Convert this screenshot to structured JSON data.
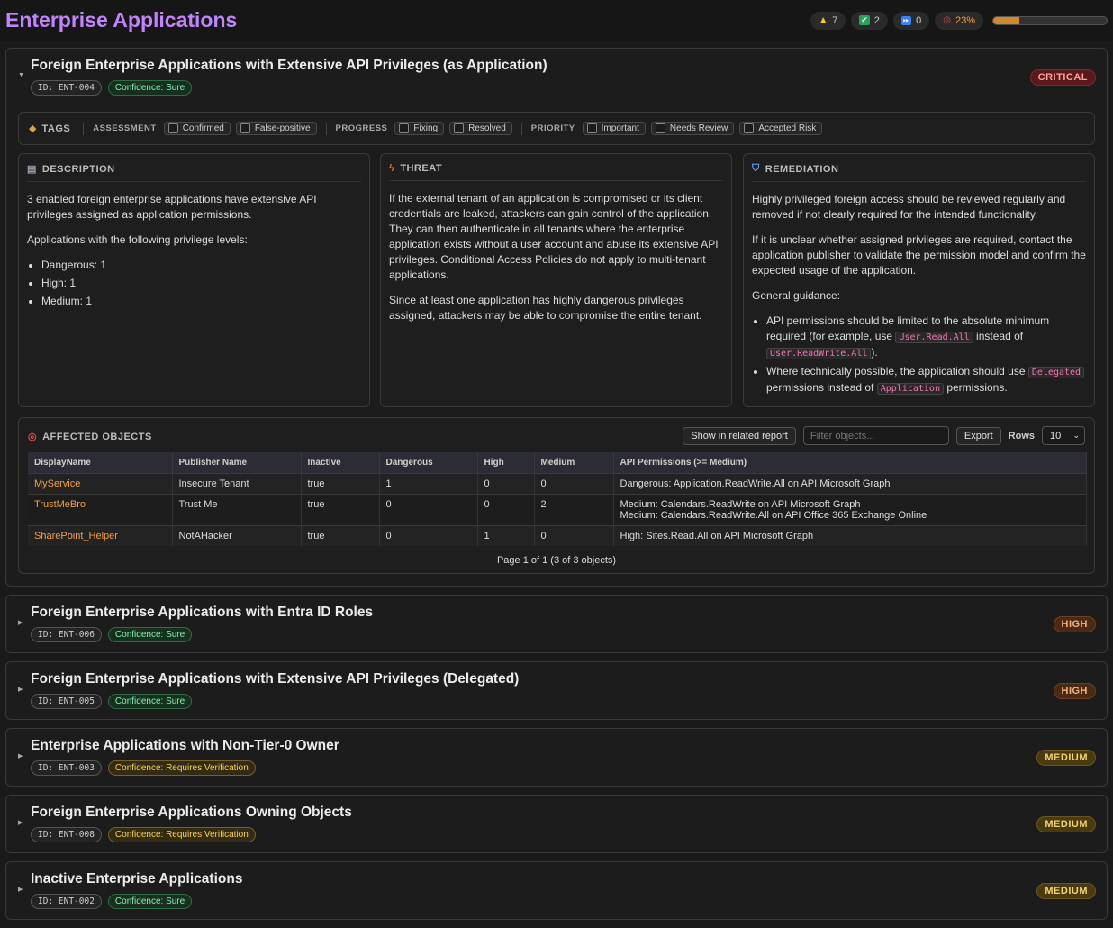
{
  "header": {
    "title": "Enterprise Applications",
    "stats": {
      "warnings": "7",
      "checked": "2",
      "skipped": "0",
      "progress_label": "23%",
      "progress_value": 0.23
    }
  },
  "expanded_finding": {
    "title": "Foreign Enterprise Applications with Extensive API Privileges (as Application)",
    "id": "ID: ENT-004",
    "confidence": "Confidence: Sure",
    "severity": "CRITICAL",
    "tags": {
      "title": "TAGS",
      "groups": [
        {
          "label": "ASSESSMENT",
          "options": [
            "Confirmed",
            "False-positive"
          ]
        },
        {
          "label": "PROGRESS",
          "options": [
            "Fixing",
            "Resolved"
          ]
        },
        {
          "label": "PRIORITY",
          "options": [
            "Important",
            "Needs Review",
            "Accepted Risk"
          ]
        }
      ]
    },
    "description": {
      "title": "DESCRIPTION",
      "p1": "3 enabled foreign enterprise applications have extensive API privileges assigned as application permissions.",
      "p2": "Applications with the following privilege levels:",
      "items": [
        "Dangerous: 1",
        "High: 1",
        "Medium: 1"
      ]
    },
    "threat": {
      "title": "THREAT",
      "p1": "If the external tenant of an application is compromised or its client credentials are leaked, attackers can gain control of the application. They can then authenticate in all tenants where the enterprise application exists without a user account and abuse its extensive API privileges. Conditional Access Policies do not apply to multi-tenant applications.",
      "p2": "Since at least one application has highly dangerous privileges assigned, attackers may be able to compromise the entire tenant."
    },
    "remediation": {
      "title": "REMEDIATION",
      "p1": "Highly privileged foreign access should be reviewed regularly and removed if not clearly required for the intended functionality.",
      "p2": "If it is unclear whether assigned privileges are required, contact the application publisher to validate the permission model and confirm the expected usage of the application.",
      "p3": "General guidance:",
      "b1_a": "API permissions should be limited to the absolute minimum required (for example, use",
      "b1_code1": "User.Read.All",
      "b1_b": "instead of",
      "b1_code2": "User.ReadWrite.All",
      "b1_c": ").",
      "b2_a": "Where technically possible, the application should use",
      "b2_code1": "Delegated",
      "b2_b": "permissions instead of",
      "b2_code2": "Application",
      "b2_c": "permissions."
    },
    "affected": {
      "title": "AFFECTED OBJECTS",
      "related_button": "Show in related report",
      "filter_placeholder": "Filter objects...",
      "export_button": "Export",
      "rows_label": "Rows",
      "rows_value": "10",
      "columns": [
        "DisplayName",
        "Publisher Name",
        "Inactive",
        "Dangerous",
        "High",
        "Medium",
        "API Permissions (>= Medium)"
      ],
      "rows": [
        {
          "name": "MyService",
          "publisher": "Insecure Tenant",
          "inactive": "true",
          "dangerous": "1",
          "high": "0",
          "medium": "0",
          "perm1": "Dangerous: Application.ReadWrite.All on API Microsoft Graph",
          "perm2": ""
        },
        {
          "name": "TrustMeBro",
          "publisher": "Trust Me",
          "inactive": "true",
          "dangerous": "0",
          "high": "0",
          "medium": "2",
          "perm1": "Medium: Calendars.ReadWrite on API Microsoft Graph",
          "perm2": "Medium: Calendars.ReadWrite.All on API Office 365 Exchange Online"
        },
        {
          "name": "SharePoint_Helper",
          "publisher": "NotAHacker",
          "inactive": "true",
          "dangerous": "0",
          "high": "1",
          "medium": "0",
          "perm1": "High: Sites.Read.All on API Microsoft Graph",
          "perm2": ""
        }
      ],
      "pager": "Page 1 of 1 (3 of 3 objects)"
    }
  },
  "collapsed_findings": [
    {
      "title": "Foreign Enterprise Applications with Entra ID Roles",
      "id": "ID: ENT-006",
      "confidence": "Confidence: Sure",
      "severity": "HIGH"
    },
    {
      "title": "Foreign Enterprise Applications with Extensive API Privileges (Delegated)",
      "id": "ID: ENT-005",
      "confidence": "Confidence: Sure",
      "severity": "HIGH"
    },
    {
      "title": "Enterprise Applications with Non-Tier-0 Owner",
      "id": "ID: ENT-003",
      "confidence": "Confidence: Requires Verification",
      "severity": "MEDIUM"
    },
    {
      "title": "Foreign Enterprise Applications Owning Objects",
      "id": "ID: ENT-008",
      "confidence": "Confidence: Requires Verification",
      "severity": "MEDIUM"
    },
    {
      "title": "Inactive Enterprise Applications",
      "id": "ID: ENT-002",
      "confidence": "Confidence: Sure",
      "severity": "MEDIUM"
    }
  ],
  "icons": {
    "warning": "warning-icon",
    "check": "check-icon",
    "skip": "skip-icon",
    "target": "target-icon",
    "tag": "tag-icon",
    "doc": "document-icon",
    "bolt": "bolt-icon",
    "shield": "shield-icon"
  }
}
